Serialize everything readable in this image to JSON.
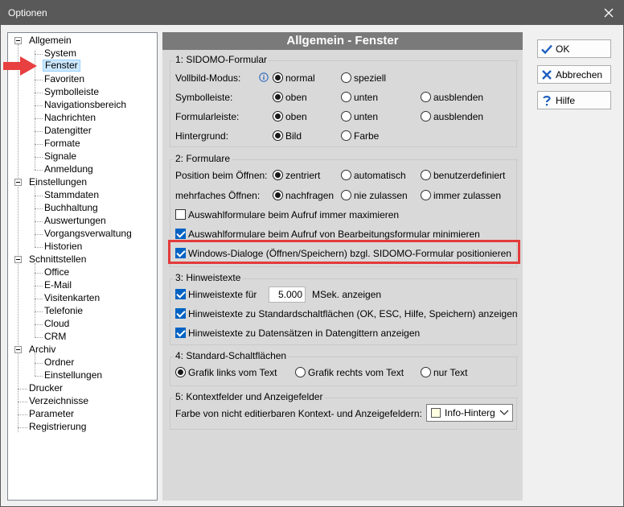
{
  "window": {
    "title": "Optionen"
  },
  "tree": {
    "items": [
      {
        "label": "Allgemein"
      },
      {
        "label": "System"
      },
      {
        "label": "Fenster"
      },
      {
        "label": "Favoriten"
      },
      {
        "label": "Symbolleiste"
      },
      {
        "label": "Navigationsbereich"
      },
      {
        "label": "Nachrichten"
      },
      {
        "label": "Datengitter"
      },
      {
        "label": "Formate"
      },
      {
        "label": "Signale"
      },
      {
        "label": "Anmeldung"
      },
      {
        "label": "Einstellungen"
      },
      {
        "label": "Stammdaten"
      },
      {
        "label": "Buchhaltung"
      },
      {
        "label": "Auswertungen"
      },
      {
        "label": "Vorgangsverwaltung"
      },
      {
        "label": "Historien"
      },
      {
        "label": "Schnittstellen"
      },
      {
        "label": "Office"
      },
      {
        "label": "E-Mail"
      },
      {
        "label": "Visitenkarten"
      },
      {
        "label": "Telefonie"
      },
      {
        "label": "Cloud"
      },
      {
        "label": "CRM"
      },
      {
        "label": "Archiv"
      },
      {
        "label": "Ordner"
      },
      {
        "label": "Einstellungen"
      },
      {
        "label": "Drucker"
      },
      {
        "label": "Verzeichnisse"
      },
      {
        "label": "Parameter"
      },
      {
        "label": "Registrierung"
      }
    ]
  },
  "panel": {
    "title": "Allgemein - Fenster",
    "g1": {
      "title": "1: SIDOMO-Formular",
      "vollbild_label": "Vollbild-Modus:",
      "vollbild_opts": [
        "normal",
        "speziell"
      ],
      "symbol_label": "Symbolleiste:",
      "formular_label": "Formularleiste:",
      "bar_opts": [
        "oben",
        "unten",
        "ausblenden"
      ],
      "hintergrund_label": "Hintergrund:",
      "hintergrund_opts": [
        "Bild",
        "Farbe"
      ]
    },
    "g2": {
      "title": "2: Formulare",
      "pos_label": "Position beim Öffnen:",
      "pos_opts": [
        "zentriert",
        "automatisch",
        "benutzerdefiniert"
      ],
      "mehr_label": "mehrfaches Öffnen:",
      "mehr_opts": [
        "nachfragen",
        "nie zulassen",
        "immer zulassen"
      ],
      "cb1": "Auswahlformulare beim Aufruf immer maximieren",
      "cb2": "Auswahlformulare beim Aufruf von Bearbeitungsformular minimieren",
      "cb3": "Windows-Dialoge (Öffnen/Speichern) bzgl. SIDOMO-Formular positionieren"
    },
    "g3": {
      "title": "3: Hinweistexte",
      "cb1_prefix": "Hinweistexte für",
      "cb1_value": "5.000",
      "cb1_suffix": "MSek. anzeigen",
      "cb2": "Hinweistexte zu Standardschaltflächen (OK, ESC, Hilfe, Speichern) anzeigen",
      "cb3": "Hinweistexte zu Datensätzen in Datengittern anzeigen"
    },
    "g4": {
      "title": "4: Standard-Schaltflächen",
      "opts": [
        "Grafik links vom Text",
        "Grafik rechts vom Text",
        "nur Text"
      ]
    },
    "g5": {
      "title": "5: Kontextfelder und Anzeigefelder",
      "label": "Farbe von nicht editierbaren Kontext- und Anzeigefeldern:",
      "combo_value": "Info-Hinterg"
    }
  },
  "buttons": {
    "ok": "OK",
    "cancel": "Abbrechen",
    "help": "Hilfe"
  },
  "colors": {
    "accent": "#0063c4",
    "highlight": "#e33a3a",
    "arrow": "#e84040",
    "swatch": "#ffffe1"
  }
}
